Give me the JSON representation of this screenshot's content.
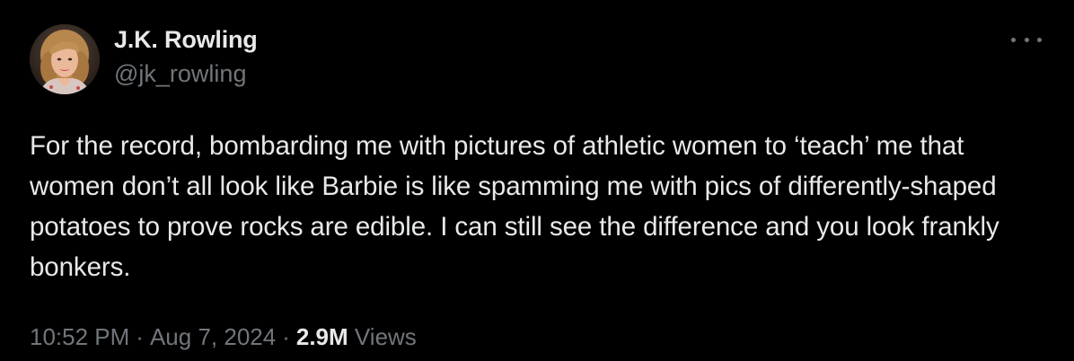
{
  "author": {
    "display_name": "J.K. Rowling",
    "handle": "@jk_rowling"
  },
  "more_icon": "more-horizontal-icon",
  "tweet": {
    "text": "For the record, bombarding me with pictures of athletic women to ‘teach’ me that women don’t all look like Barbie is like spamming me with pics of differently-shaped potatoes to prove rocks are edible. I can still see the difference and you look frankly bonkers."
  },
  "meta": {
    "time": "10:52 PM",
    "separator": "·",
    "date": "Aug 7, 2024",
    "views_count": "2.9M",
    "views_label": "Views"
  },
  "colors": {
    "background": "#000000",
    "primary_text": "#e7e9ea",
    "secondary_text": "#71767b"
  }
}
